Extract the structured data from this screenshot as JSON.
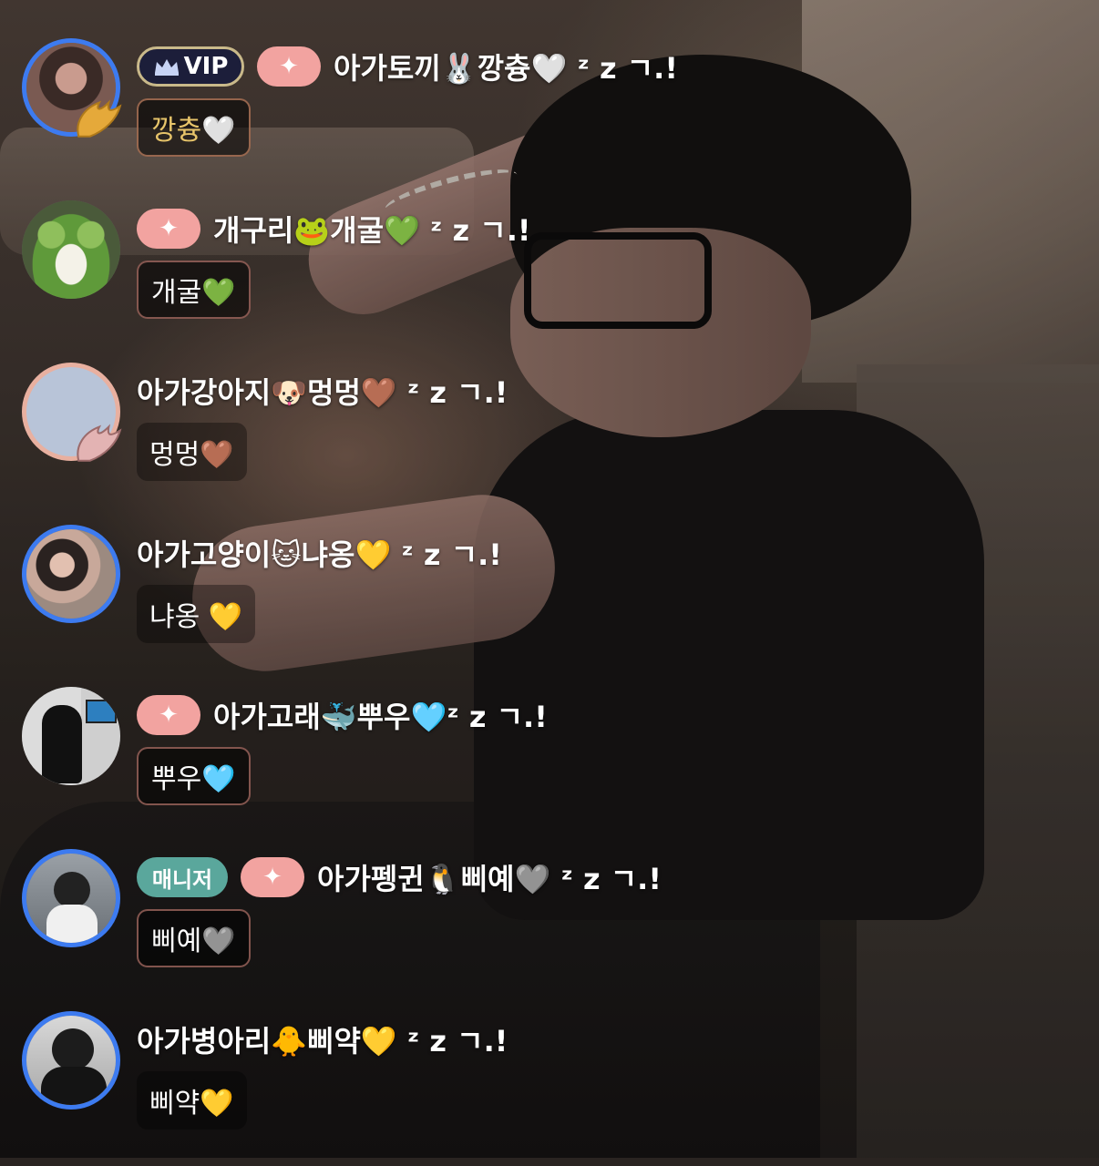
{
  "messages": [
    {
      "badges": [
        "VIP",
        "✦"
      ],
      "nickname": "아가토끼🐰깡츙🤍 ᶻ z ㄱ.!",
      "text": "깡츙🤍",
      "avatar_border": "#3d7bf0",
      "has_wing": true,
      "wing_color": "gold",
      "text_color": "gold"
    },
    {
      "badges": [
        "✦"
      ],
      "nickname": "개구리🐸개굴💚 ᶻ z ㄱ.!",
      "text": "개굴💚",
      "avatar_border": "none",
      "has_wing": false
    },
    {
      "badges": [],
      "nickname": "아가강아지🐶멍멍🤎 ᶻ z ㄱ.!",
      "text": "멍멍🤎",
      "avatar_border": "#e8b0a0",
      "has_wing": true,
      "wing_color": "pink"
    },
    {
      "badges": [],
      "nickname": "아가고양이🐱냐옹💛 ᶻ z ㄱ.!",
      "text": "냐옹 💛",
      "avatar_border": "#3d7bf0",
      "has_wing": false
    },
    {
      "badges": [
        "✦"
      ],
      "nickname": "아가고래🐳뿌우🩵ᶻ z ㄱ.!",
      "text": "뿌우🩵",
      "avatar_border": "none",
      "has_wing": false
    },
    {
      "badges": [
        "매니저",
        "✦"
      ],
      "nickname": "아가펭귄🐧삐예🩶 ᶻ z ㄱ.!",
      "text": "삐예🩶",
      "avatar_border": "#3d7bf0",
      "has_wing": false
    },
    {
      "badges": [],
      "nickname": "아가병아리🐥삐약💛 ᶻ z ㄱ.!",
      "text": "삐약💛",
      "avatar_border": "#3d7bf0",
      "has_wing": false
    }
  ],
  "colors": {
    "avatar_ring": "#3d7bf0",
    "badge_star": "#f2a3a0",
    "badge_manager": "#5aa79c",
    "badge_vip_bg": "#1c1e3a",
    "badge_vip_border": "#c9b98a"
  },
  "icons": [
    "crown-icon",
    "sparkle-icon",
    "wing-icon"
  ]
}
